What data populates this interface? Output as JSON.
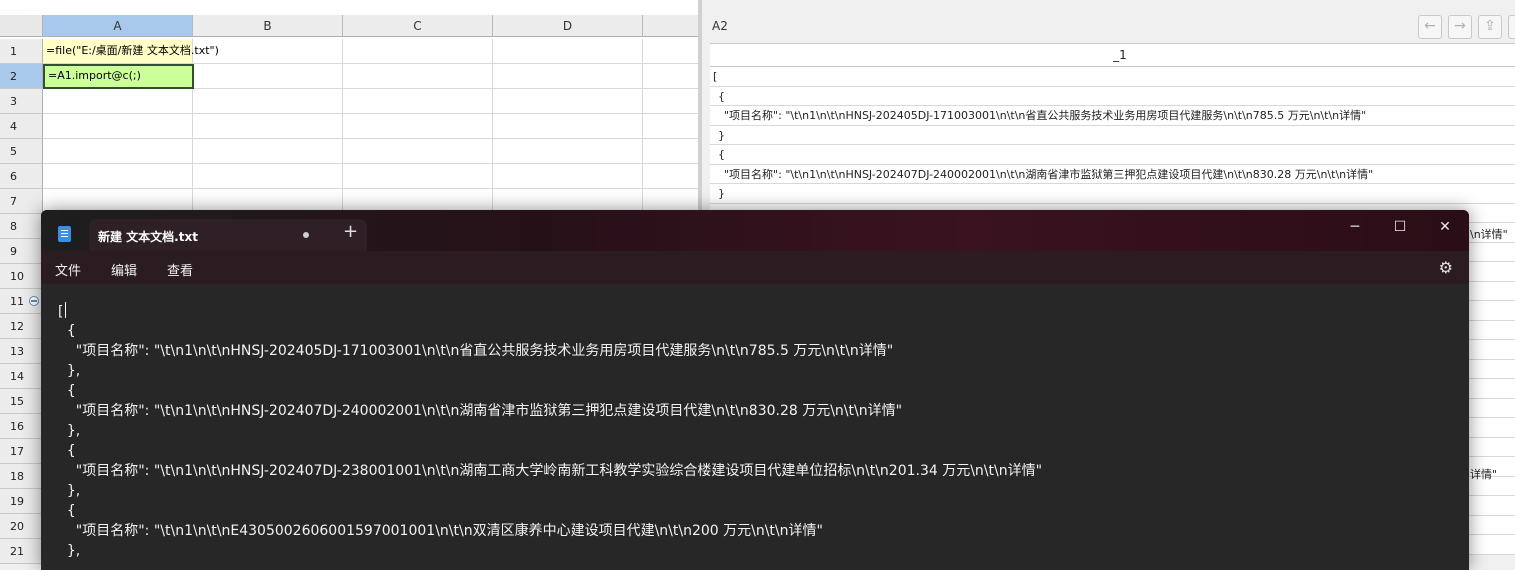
{
  "sheet": {
    "columns": [
      "A",
      "B",
      "C",
      "D"
    ],
    "rows": [
      "1",
      "2",
      "3",
      "4",
      "5",
      "6",
      "7",
      "8",
      "9",
      "10",
      "11",
      "12",
      "13",
      "14",
      "15",
      "16",
      "17",
      "18",
      "19",
      "20",
      "21"
    ],
    "cells": {
      "A1": "=file(\"E:/桌面/新建 文本文档.txt\")",
      "A2": "=A1.import@c(;)"
    }
  },
  "right_panel": {
    "cell_ref": "A2",
    "column_header": "_1",
    "rows": [
      "[",
      "{",
      "\"项目名称\": \"\\t\\n1\\n\\t\\nHNSJ-202405DJ-171003001\\n\\t\\n省直公共服务技术业务用房项目代建服务\\n\\t\\n785.5 万元\\n\\t\\n详情\"",
      "}",
      "{",
      "\"项目名称\": \"\\t\\n1\\n\\t\\nHNSJ-202407DJ-240002001\\n\\t\\n湖南省津市监狱第三押犯点建设项目代建\\n\\t\\n830.28 万元\\n\\t\\n详情\"",
      "}"
    ],
    "peek_texts": [
      "\\n详情\"",
      "详情\""
    ]
  },
  "notepad": {
    "tab_title": "新建 文本文档.txt",
    "menu": [
      "文件",
      "编辑",
      "查看"
    ],
    "lines": [
      "[",
      "  {",
      "    \"项目名称\": \"\\t\\n1\\n\\t\\nHNSJ-202405DJ-171003001\\n\\t\\n省直公共服务技术业务用房项目代建服务\\n\\t\\n785.5 万元\\n\\t\\n详情\"",
      "  },",
      "  {",
      "    \"项目名称\": \"\\t\\n1\\n\\t\\nHNSJ-202407DJ-240002001\\n\\t\\n湖南省津市监狱第三押犯点建设项目代建\\n\\t\\n830.28 万元\\n\\t\\n详情\"",
      "  },",
      "  {",
      "    \"项目名称\": \"\\t\\n1\\n\\t\\nHNSJ-202407DJ-238001001\\n\\t\\n湖南工商大学岭南新工科教学实验综合楼建设项目代建单位招标\\n\\t\\n201.34 万元\\n\\t\\n详情\"",
      "  },",
      "  {",
      "    \"项目名称\": \"\\t\\n1\\n\\t\\nE4305002606001597001001\\n\\t\\n双清区康养中心建设项目代建\\n\\t\\n200 万元\\n\\t\\n详情\"",
      "  },"
    ]
  },
  "colors": {
    "selected_header": "#a8c8ec",
    "formula_cell": "#ffffc8",
    "active_cell": "#ccff99",
    "editor_bg": "#272727"
  }
}
